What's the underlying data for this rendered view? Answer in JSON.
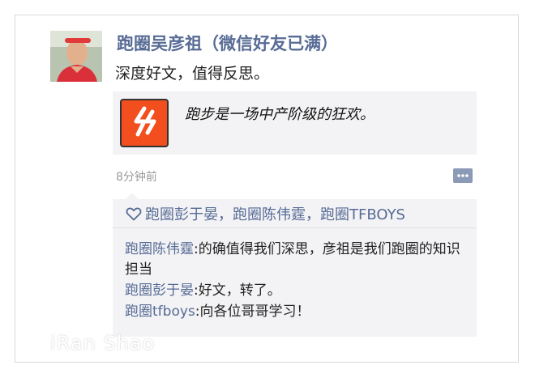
{
  "post": {
    "author": "跑圈吴彦祖（微信好友已满）",
    "text": "深度好文，值得反思。",
    "link_title": "跑步是一场中产阶级的狂欢。",
    "timestamp": "8分钟前"
  },
  "likes": {
    "names": "跑圈彭于晏，跑圈陈伟霆，跑圈TFBOYS"
  },
  "comments": [
    {
      "name": "跑圈陈伟霆",
      "sep": ":",
      "text": "的确值得我们深思，彦祖是我们跑圈的知识担当"
    },
    {
      "name": "跑圈彭于晏",
      "sep": ":",
      "text": "好文，转了。"
    },
    {
      "name": "跑圈tfboys",
      "sep": ":",
      "text": "向各位哥哥学习！"
    }
  ],
  "watermark": "iRan Shao",
  "colors": {
    "link_blue": "#576b95",
    "card_bg": "#f3f3f5",
    "thumb_orange": "#f24e1e"
  },
  "icons": {
    "heart": "heart-icon",
    "comment": "comment-bubble-icon",
    "app": "app-logo-icon"
  }
}
